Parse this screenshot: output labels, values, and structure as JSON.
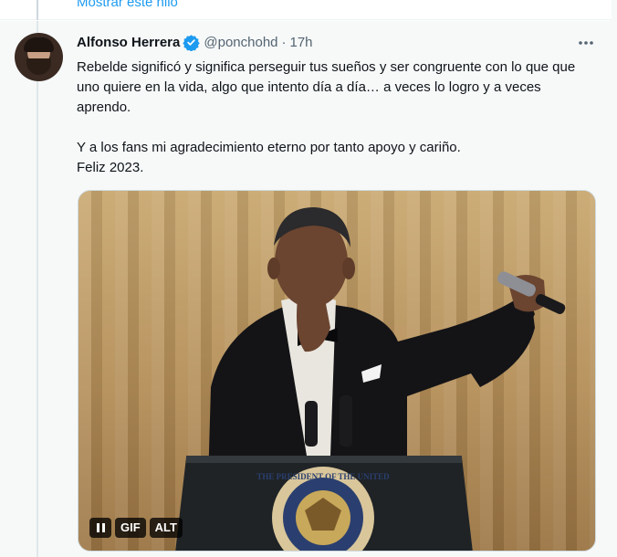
{
  "previous_tweet": {
    "show_thread_label": "Mostrar este hilo"
  },
  "tweet": {
    "author_name": "Alfonso Herrera",
    "handle": "@ponchohd",
    "separator": "·",
    "time": "17h",
    "more_icon": "more-horizontal-icon",
    "verified_icon": "verified-badge-icon",
    "text_lines": [
      "Rebelde significó y significa perseguir tus sueños y ser congruente con lo que que uno quiere en la vida, algo que intento día a día… a veces lo logro y a veces aprendo.",
      "Y a los fans mi agradecimiento eterno por tanto apoyo y cariño.",
      "Feliz 2023."
    ],
    "media": {
      "type": "gif",
      "pause_icon": "pause-icon",
      "gif_label": "GIF",
      "alt_label": "ALT",
      "seal_text": "THE PRESIDENT OF THE UNITED"
    }
  },
  "colors": {
    "accent": "#1d9bf0",
    "muted": "#536471",
    "text": "#0f1419",
    "background": "#f7f9f9"
  }
}
